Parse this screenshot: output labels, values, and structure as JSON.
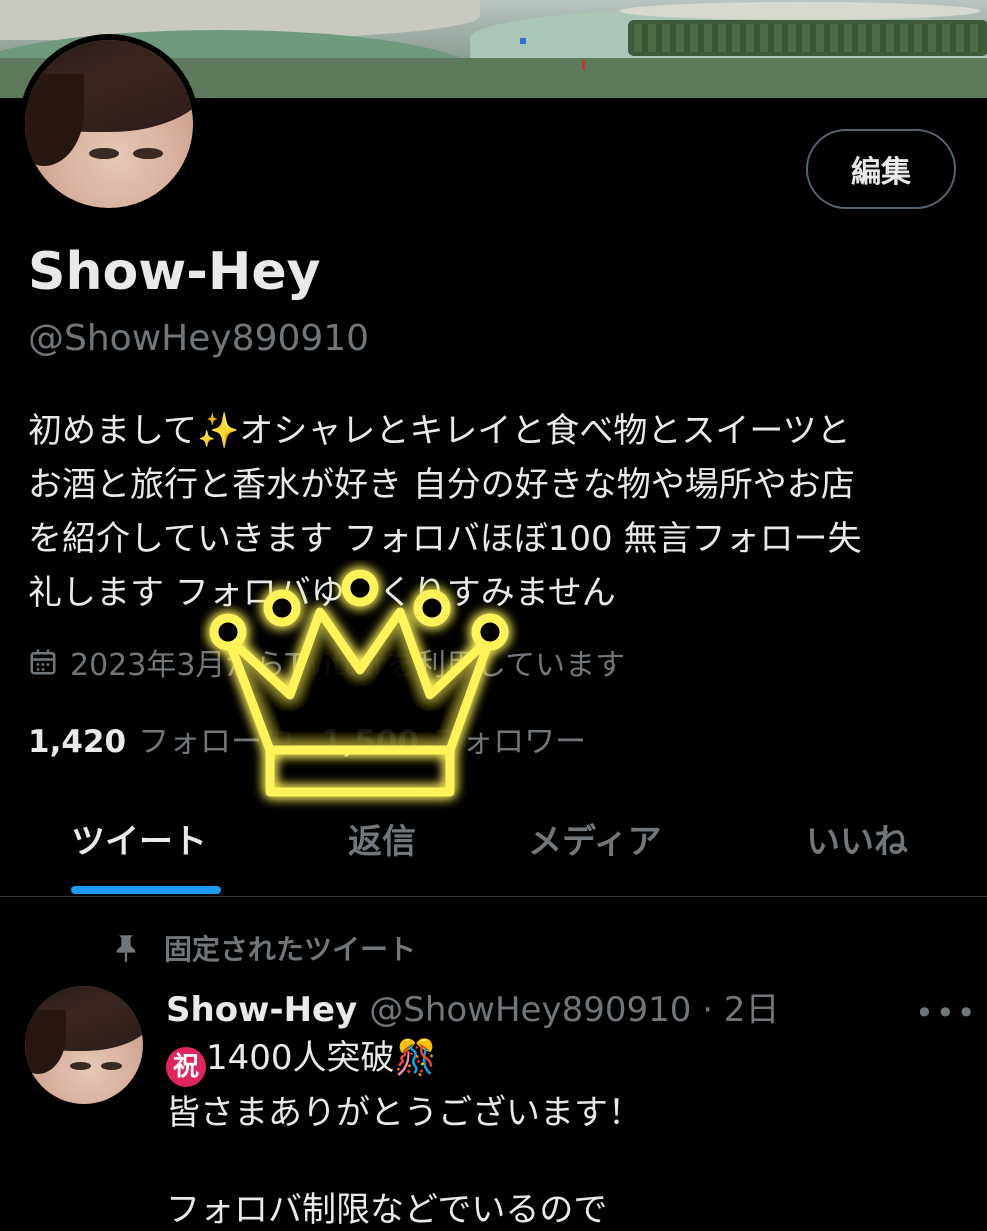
{
  "profile": {
    "edit_label": "編集",
    "display_name": "Show-Hey",
    "handle": "@ShowHey890910",
    "bio": "初めまして✨オシャレとキレイと食べ物とスイーツと\nお酒と旅行と香水が好き 自分の好きな物や場所やお店\nを紹介していきます フォロバほぼ100 無言フォロー失\n礼します フォロバゆっくりすみません",
    "joined": "2023年3月からTwitterを利用しています",
    "following_count": "1,420",
    "following_label": "フォロー中",
    "followers_count": "1,500",
    "followers_label": "フォロワー"
  },
  "tabs": [
    {
      "label": "ツイート",
      "active": true
    },
    {
      "label": "返信",
      "active": false
    },
    {
      "label": "メディア",
      "active": false
    },
    {
      "label": "いいね",
      "active": false
    }
  ],
  "pinned_tweet": {
    "pinned_label": "固定されたツイート",
    "name": "Show-Hey",
    "meta": "@ShowHey890910 · 2日",
    "more": "•••",
    "badge": "祝",
    "line1": "1400人突破🎊",
    "line2": "皆さまありがとうございます！",
    "cut_line": "フォロバ制限などでいるので"
  },
  "colors": {
    "background": "#000000",
    "text_primary": "#e7e9ea",
    "text_secondary": "#71767b",
    "accent": "#1d9bf0",
    "crown": "#fff35a"
  },
  "icons": [
    "calendar-icon",
    "pin-icon",
    "more-icon",
    "crown-sticker"
  ]
}
